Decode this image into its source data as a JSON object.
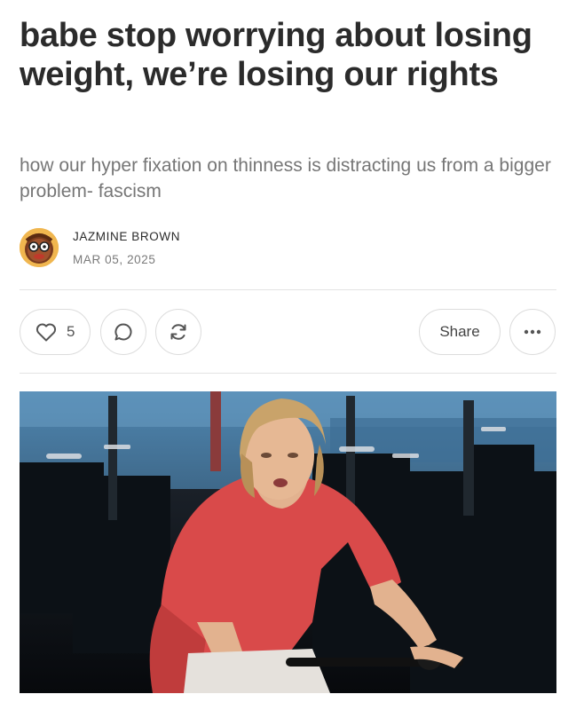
{
  "post": {
    "title": "babe stop worrying about losing weight, we’re losing our rights",
    "subtitle": "how our hyper fixation on thinness is distracting us from a bigger problem- fascism",
    "author": "JAZMINE BROWN",
    "date": "MAR 05, 2025"
  },
  "actions": {
    "like_count": "5",
    "share_label": "Share",
    "icons": [
      "heart-icon",
      "comment-icon",
      "restack-icon",
      "more-icon"
    ]
  },
  "colors": {
    "title": "#2b2b2b",
    "subtitle": "#767676",
    "divider": "#e3e3e3",
    "shirt": "#d94a4a"
  }
}
